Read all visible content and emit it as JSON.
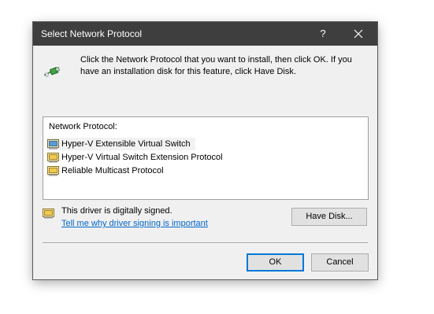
{
  "window": {
    "title": "Select Network Protocol",
    "help_glyph": "?"
  },
  "instruction_text": "Click the Network Protocol that you want to install, then click OK. If you have an installation disk for this feature, click Have Disk.",
  "protocol_list": {
    "label": "Network Protocol:",
    "items": [
      {
        "label": "Hyper-V Extensible Virtual Switch",
        "selected": true,
        "icon": "network-protocol-icon"
      },
      {
        "label": "Hyper-V Virtual Switch Extension Protocol",
        "selected": false,
        "icon": "network-protocol-icon"
      },
      {
        "label": "Reliable Multicast Protocol",
        "selected": false,
        "icon": "network-protocol-icon"
      }
    ]
  },
  "driver_signing": {
    "status_text": "This driver is digitally signed.",
    "link_text": "Tell me why driver signing is important",
    "icon": "signed-driver-icon"
  },
  "buttons": {
    "have_disk": "Have Disk...",
    "ok": "OK",
    "cancel": "Cancel"
  },
  "colors": {
    "titlebar": "#3e3e3e",
    "dialog_bg": "#f0f0f0",
    "link": "#0066cc",
    "default_button_border": "#0078d7"
  }
}
